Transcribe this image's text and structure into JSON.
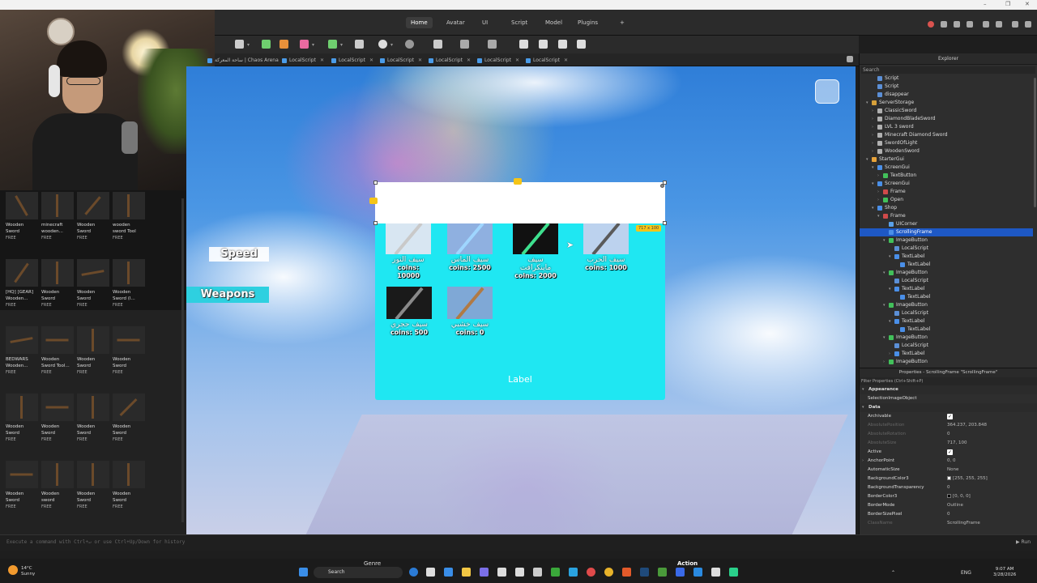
{
  "window_controls": [
    "–",
    "❐",
    "✕"
  ],
  "menu": {
    "tabs": [
      {
        "label": "Home",
        "active": true
      },
      {
        "label": "Avatar",
        "active": false
      },
      {
        "label": "UI",
        "active": false
      },
      {
        "label": "Script",
        "active": false
      },
      {
        "label": "Model",
        "active": false
      },
      {
        "label": "Plugins",
        "active": false
      },
      {
        "label": "+",
        "active": false
      }
    ]
  },
  "doc_tabs": [
    {
      "label": "ساحة المعركة | Chaos Arena",
      "close": "✕"
    },
    {
      "label": "LocalScript",
      "close": "✕"
    },
    {
      "label": "LocalScript",
      "close": "✕"
    },
    {
      "label": "LocalScript",
      "close": "✕"
    },
    {
      "label": "LocalScript",
      "close": "✕"
    },
    {
      "label": "LocalScript",
      "close": "✕"
    },
    {
      "label": "LocalScript",
      "close": "✕"
    }
  ],
  "toolbox": {
    "items": [
      {
        "name": "Wooden\nSword",
        "price": "FREE"
      },
      {
        "name": "minecraft\nwooden...",
        "price": "FREE"
      },
      {
        "name": "Wooden\nSword",
        "price": "FREE"
      },
      {
        "name": "wooden\nsword Tool",
        "price": "FREE"
      },
      {
        "name": "[HQ] [GEAR]\nWooden...",
        "price": "FREE"
      },
      {
        "name": "Wooden\nSword",
        "price": "FREE"
      },
      {
        "name": "Wooden\nSword",
        "price": "FREE"
      },
      {
        "name": "Wooden\nSword (I...",
        "price": "FREE"
      },
      {
        "name": "BEDWARS\nWooden...",
        "price": "FREE"
      },
      {
        "name": "Wooden\nSword Tool...",
        "price": "FREE"
      },
      {
        "name": "Wooden\nSword",
        "price": "FREE"
      },
      {
        "name": "Wooden\nSword",
        "price": "FREE"
      },
      {
        "name": "Wooden\nSword",
        "price": "FREE"
      },
      {
        "name": "Wooden\nSword",
        "price": "FREE"
      },
      {
        "name": "Wooden\nSword",
        "price": "FREE"
      },
      {
        "name": "Wooden\nSword",
        "price": "FREE"
      },
      {
        "name": "Wooden\nSword",
        "price": "FREE"
      },
      {
        "name": "Wooden\nsword",
        "price": "FREE"
      },
      {
        "name": "Wooden\nSword",
        "price": "FREE"
      },
      {
        "name": "Wooden\nSword",
        "price": "FREE"
      }
    ]
  },
  "game": {
    "speed_label": "Speed",
    "weapons_label": "Weapons",
    "shop_label": "Label",
    "size_badge": "717 x 100",
    "swords": [
      {
        "name_ar": "سيف النور",
        "coins": "coins: 10000",
        "blade": "#c9c9c9",
        "bg": "#d8e6f2"
      },
      {
        "name_ar": "سيف الماس",
        "coins": "coins: 2500",
        "blade": "#9fd6ff",
        "bg": "#8fb0e0"
      },
      {
        "name_ar": "سيف ماينكرافت",
        "coins": "coins: 2000",
        "blade": "#3ee08f",
        "bg": "#111111"
      },
      {
        "name_ar": "سيف الحرب",
        "coins": "coins: 1000",
        "blade": "#5a5a5a",
        "bg": "#bcd2ee"
      },
      {
        "name_ar": "سيف حجري",
        "coins": "coins: 500",
        "blade": "#8a8a8a",
        "bg": "#1a1a1a"
      },
      {
        "name_ar": "سيف خشبي",
        "coins": "coins: 0",
        "blade": "#b07a45",
        "bg": "#7fa8d6"
      }
    ]
  },
  "explorer": {
    "title": "Explorer",
    "search_placeholder": "Search",
    "rows": [
      {
        "label": "Script",
        "depth": 1,
        "icon": "script",
        "arrow": ""
      },
      {
        "label": "Script",
        "depth": 1,
        "icon": "script",
        "arrow": ""
      },
      {
        "label": "disappear",
        "depth": 1,
        "icon": "script",
        "arrow": ""
      },
      {
        "label": "ServerStorage",
        "depth": 0,
        "icon": "folder",
        "arrow": "▾"
      },
      {
        "label": "ClassicSword",
        "depth": 1,
        "icon": "tool",
        "arrow": "›"
      },
      {
        "label": "DiamondBladeSword",
        "depth": 1,
        "icon": "tool",
        "arrow": "›"
      },
      {
        "label": "LVL 3 sword",
        "depth": 1,
        "icon": "tool",
        "arrow": "›"
      },
      {
        "label": "Minecraft Diamond Sword",
        "depth": 1,
        "icon": "tool",
        "arrow": "›"
      },
      {
        "label": "SwordOfLight",
        "depth": 1,
        "icon": "tool",
        "arrow": "›"
      },
      {
        "label": "WoodenSword",
        "depth": 1,
        "icon": "tool",
        "arrow": "›"
      },
      {
        "label": "StarterGui",
        "depth": 0,
        "icon": "gui",
        "arrow": "▾"
      },
      {
        "label": "ScreenGui",
        "depth": 1,
        "icon": "screengui",
        "arrow": "▾"
      },
      {
        "label": "TextButton",
        "depth": 2,
        "icon": "button",
        "arrow": "›"
      },
      {
        "label": "ScreenGui",
        "depth": 1,
        "icon": "screengui",
        "arrow": "▾"
      },
      {
        "label": "Frame",
        "depth": 2,
        "icon": "frame",
        "arrow": "›"
      },
      {
        "label": "Open",
        "depth": 2,
        "icon": "button",
        "arrow": "›"
      },
      {
        "label": "Shop",
        "depth": 1,
        "icon": "screengui",
        "arrow": "▾"
      },
      {
        "label": "Frame",
        "depth": 2,
        "icon": "frame",
        "arrow": "▾"
      },
      {
        "label": "UICorner",
        "depth": 3,
        "icon": "corner",
        "arrow": ""
      },
      {
        "label": "ScrollingFrame",
        "depth": 3,
        "icon": "scrolling",
        "arrow": "",
        "selected": true
      },
      {
        "label": "ImageButton",
        "depth": 3,
        "icon": "button",
        "arrow": "▾"
      },
      {
        "label": "LocalScript",
        "depth": 4,
        "icon": "script",
        "arrow": ""
      },
      {
        "label": "TextLabel",
        "depth": 4,
        "icon": "text",
        "arrow": "▾"
      },
      {
        "label": "TextLabel",
        "depth": 5,
        "icon": "text",
        "arrow": ""
      },
      {
        "label": "ImageButton",
        "depth": 3,
        "icon": "button",
        "arrow": "▾"
      },
      {
        "label": "LocalScript",
        "depth": 4,
        "icon": "script",
        "arrow": ""
      },
      {
        "label": "TextLabel",
        "depth": 4,
        "icon": "text",
        "arrow": "▾"
      },
      {
        "label": "TextLabel",
        "depth": 5,
        "icon": "text",
        "arrow": ""
      },
      {
        "label": "ImageButton",
        "depth": 3,
        "icon": "button",
        "arrow": "▾"
      },
      {
        "label": "LocalScript",
        "depth": 4,
        "icon": "script",
        "arrow": ""
      },
      {
        "label": "TextLabel",
        "depth": 4,
        "icon": "text",
        "arrow": "▾"
      },
      {
        "label": "TextLabel",
        "depth": 5,
        "icon": "text",
        "arrow": ""
      },
      {
        "label": "ImageButton",
        "depth": 3,
        "icon": "button",
        "arrow": "▾"
      },
      {
        "label": "LocalScript",
        "depth": 4,
        "icon": "script",
        "arrow": ""
      },
      {
        "label": "TextLabel",
        "depth": 4,
        "icon": "text",
        "arrow": "›"
      },
      {
        "label": "ImageButton",
        "depth": 3,
        "icon": "button",
        "arrow": "›"
      }
    ]
  },
  "properties": {
    "title": "Properties - ScrollingFrame \"ScrollingFrame\"",
    "filter_placeholder": "Filter Properties (Ctrl+Shift+P)",
    "rows": [
      {
        "type": "section",
        "key": "Appearance"
      },
      {
        "type": "prop",
        "key": "SelectionImageObject",
        "value": ""
      },
      {
        "type": "section",
        "key": "Data"
      },
      {
        "type": "check",
        "key": "Archivable",
        "value": "✓"
      },
      {
        "type": "dim",
        "key": "AbsolutePosition",
        "value": "364.237, 203.848"
      },
      {
        "type": "dim",
        "key": "AbsoluteRotation",
        "value": "0"
      },
      {
        "type": "dim",
        "key": "AbsoluteSize",
        "value": "717, 100"
      },
      {
        "type": "check",
        "key": "Active",
        "value": "✓"
      },
      {
        "type": "prop",
        "key": "AnchorPoint",
        "value": "0, 0",
        "expand": true
      },
      {
        "type": "prop",
        "key": "AutomaticSize",
        "value": "None"
      },
      {
        "type": "color",
        "key": "BackgroundColor3",
        "value": "[255, 255, 255]",
        "swatch": "#ffffff"
      },
      {
        "type": "prop",
        "key": "BackgroundTransparency",
        "value": "0"
      },
      {
        "type": "color",
        "key": "BorderColor3",
        "value": "[0, 0, 0]",
        "swatch": "#000000"
      },
      {
        "type": "prop",
        "key": "BorderMode",
        "value": "Outline"
      },
      {
        "type": "prop",
        "key": "BorderSizePixel",
        "value": "0"
      },
      {
        "type": "dim",
        "key": "ClassName",
        "value": "ScrollingFrame"
      }
    ]
  },
  "command_bar": {
    "placeholder": "Execute a command with Ctrl+↵ or use Ctrl+Up/Down for history",
    "run_label": "▶ Run"
  },
  "taskbar": {
    "weather_temp": "14°C",
    "weather_desc": "Sunny",
    "search_label": "Search",
    "genre_label": "Genre",
    "action_label": "Action",
    "lang": "ENG",
    "time": "9:07 AM",
    "date": "3/28/2026"
  }
}
